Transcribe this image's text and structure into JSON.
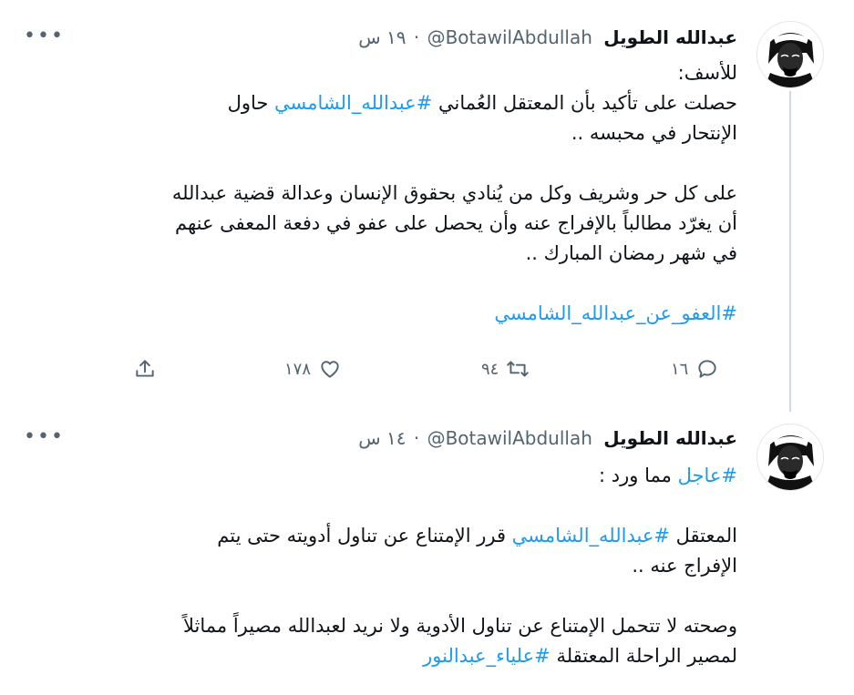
{
  "tweets": [
    {
      "author_name": "عبدالله الطويل",
      "handle": "@BotawilAbdullah",
      "time": "١٩ س",
      "more_label": "•••",
      "lines": [
        [
          {
            "t": "للأسف:"
          }
        ],
        [
          {
            "t": "حصلت على تأكيد بأن المعتقل العُماني "
          },
          {
            "t": "#عبدالله_الشامسي",
            "tag": true
          },
          {
            "t": " حاول"
          }
        ],
        [
          {
            "t": "الإنتحار في محبسه .."
          }
        ],
        [],
        [
          {
            "t": "على كل حر وشريف وكل من يُنادي بحقوق الإنسان وعدالة قضية عبدالله"
          }
        ],
        [
          {
            "t": "أن يغرّد مطالباً بالإفراج عنه وأن يحصل على عفو في دفعة المعفى عنهم"
          }
        ],
        [
          {
            "t": "في شهر رمضان المبارك .."
          }
        ],
        [],
        [
          {
            "t": "#العفو_عن_عبدالله_الشامسي",
            "tag": true
          }
        ]
      ],
      "actions": {
        "reply_count": "١٦",
        "retweet_count": "٩٤",
        "like_count": "١٧٨",
        "reply_icon": "reply-icon",
        "retweet_icon": "retweet-icon",
        "like_icon": "heart-icon",
        "share_icon": "share-icon"
      }
    },
    {
      "author_name": "عبدالله الطويل",
      "handle": "@BotawilAbdullah",
      "time": "١٤ س",
      "more_label": "•••",
      "lines": [
        [
          {
            "t": "#عاجل",
            "tag": true
          },
          {
            "t": " مما ورد :"
          }
        ],
        [],
        [
          {
            "t": "المعتقل "
          },
          {
            "t": "#عبدالله_الشامسي",
            "tag": true
          },
          {
            "t": " قرر الإمتناع عن تناول أدويته حتى يتم"
          }
        ],
        [
          {
            "t": "الإفراج عنه .."
          }
        ],
        [],
        [
          {
            "t": "وصحته لا تتحمل الإمتناع عن تناول الأدوية ولا نريد لعبدالله مصيراً مماثلاً"
          }
        ],
        [
          {
            "t": "لمصير الراحلة المعتقلة "
          },
          {
            "t": "#علياء_عبدالنور",
            "tag": true
          }
        ]
      ]
    }
  ],
  "colors": {
    "link": "#1d9bf0",
    "text": "#0f1419",
    "secondary": "#536471",
    "thread_line": "#cfd9de"
  }
}
